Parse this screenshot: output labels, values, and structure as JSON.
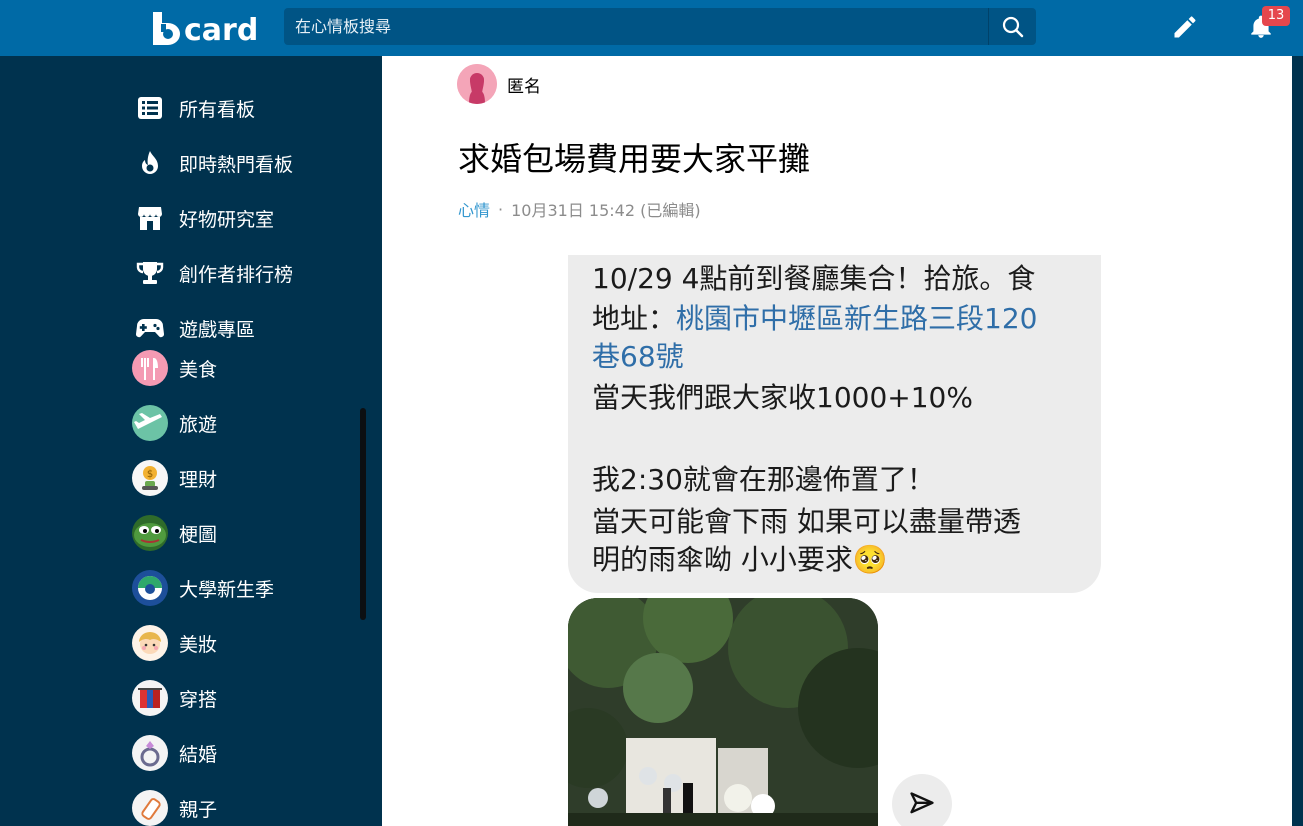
{
  "header": {
    "logo_text": "card",
    "search_placeholder": "在心情板搜尋",
    "notification_count": "13"
  },
  "sidebar": {
    "menu": [
      {
        "label": "所有看板",
        "icon": "list-icon"
      },
      {
        "label": "即時熱門看板",
        "icon": "fire-icon"
      },
      {
        "label": "好物研究室",
        "icon": "store-icon"
      },
      {
        "label": "創作者排行榜",
        "icon": "trophy-icon"
      },
      {
        "label": "遊戲專區",
        "icon": "gamepad-icon"
      }
    ],
    "boards": [
      {
        "label": "美食"
      },
      {
        "label": "旅遊"
      },
      {
        "label": "理財"
      },
      {
        "label": "梗圖"
      },
      {
        "label": "大學新生季"
      },
      {
        "label": "美妝"
      },
      {
        "label": "穿搭"
      },
      {
        "label": "結婚"
      },
      {
        "label": "親子"
      }
    ]
  },
  "post": {
    "author": "匿名",
    "title": "求婚包場費用要大家平攤",
    "forum": "心情",
    "timestamp": "10月31日 15:42 (已編輯)",
    "image_text": {
      "line1": "10/29 4點前到餐廳集合！拾旅。食",
      "line2_prefix": "地址：",
      "line2_link": "桃園市中壢區新生路三段120",
      "line3_link": "巷68號",
      "line4": "當天我們跟大家收1000+10%",
      "line5": "我2:30就會在那邊佈置了！",
      "line6": "當天可能會下雨 如果可以盡量帶透",
      "line7": "明的雨傘呦 小小要求🥺"
    }
  },
  "colors": {
    "header": "#006aa6",
    "sidebar": "#00324e",
    "link": "#3397cf"
  }
}
